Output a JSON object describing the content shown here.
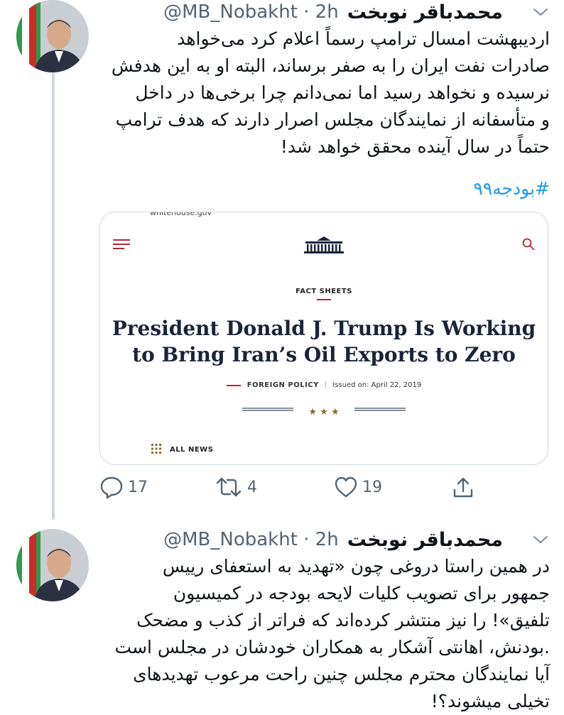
{
  "tweets": [
    {
      "name": "محمدباقر نوبخت",
      "handle": "@MB_Nobakht",
      "time": "· 2h",
      "text": "اردیبهشت امسال ترامپ رسماً اعلام کرد می‌خواهد\nصادرات نفت ایران را به صفر برساند، البته او به این هدفش\nنرسیده و نخواهد رسید اما نمی‌دانم چرا برخی‌ها در داخل\nو متأسفانه از نمایندگان مجلس اصرار دارند که هدف ترامپ\nحتماً در سال آینده محقق خواهد شد!",
      "hashtag": "#بودجه۹۹",
      "card": {
        "url": "whitehouse.gov",
        "kicker": "FACT SHEETS",
        "title_line1": "President Donald J. Trump Is Working",
        "title_line2": "to Bring Iran’s Oil Exports to Zero",
        "category": "FOREIGN POLICY",
        "issued_label": "Issued on:",
        "issued_date": "April 22, 2019",
        "stars": "★ ★ ★",
        "all_news": "ALL NEWS"
      },
      "actions": {
        "replies": "17",
        "retweets": "4",
        "likes": "19"
      },
      "icons": [
        "reply-icon",
        "retweet-icon",
        "like-icon",
        "share-icon",
        "caret-down-icon"
      ]
    },
    {
      "name": "محمدباقر نوبخت",
      "handle": "@MB_Nobakht",
      "time": "· 2h",
      "text": "در همین راستا دروغی چون «تهدید به استعفای رییس\nجمهور برای تصویب کلیات لایحه بودجه در کمیسیون\nتلفیق»! را نیز منتشر کرده‌اند که فراتر از کذب و مضحک\n.بودنش، اهانتی آشکار به همکاران خودشان در مجلس است\nآیا نمایندگان محترم مجلس چنین راحت مرعوب تهدیدهای\nتخیلی میشوند؟!"
    }
  ],
  "colors": {
    "link": "#1d9bf0",
    "muted": "#536471",
    "accent_red": "#b3263a",
    "title_navy": "#1a2438"
  }
}
